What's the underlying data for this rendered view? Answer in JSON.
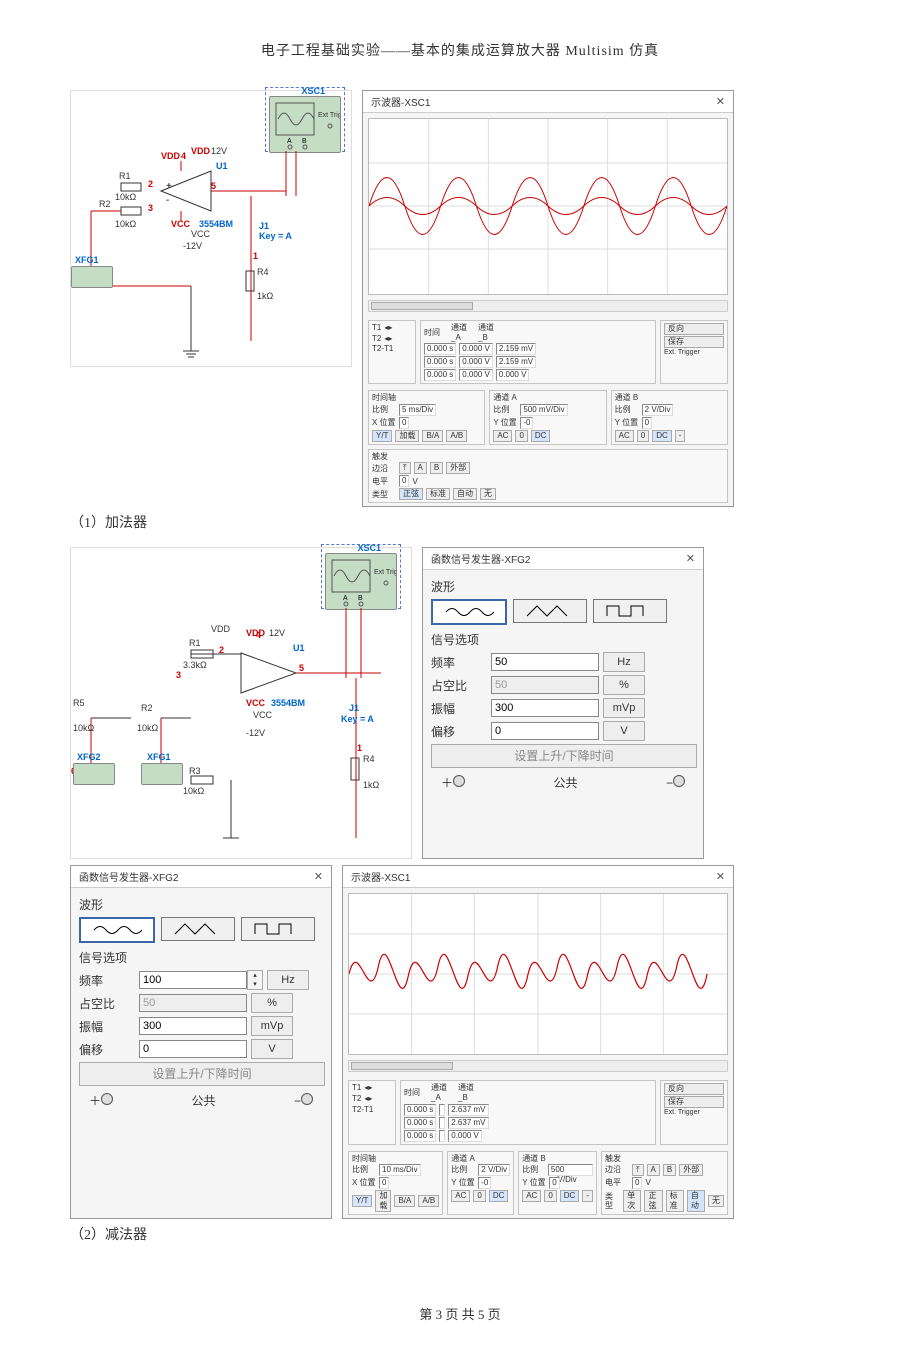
{
  "header": "电子工程基础实验——基本的集成运算放大器 Multisim 仿真",
  "footer": "第 3 页 共 5 页",
  "captions": {
    "c1": "（1）加法器",
    "c2": "（2）减法器"
  },
  "osc": {
    "title": "示波器-XSC1",
    "rev_btn": "反向",
    "save_btn": "保存",
    "ext": "Ext. Trigger",
    "rows": {
      "T1_t": "0.000 s",
      "T1_a": "0.000 V",
      "T1_b": "2.159 mV",
      "T2_t": "0.000 s",
      "T2_a": "0.000 V",
      "T2_b": "2.159 mV",
      "TT_t": "0.000 s",
      "TT_a": "0.000 V",
      "TT_b": "0.000 V"
    },
    "labels": {
      "time": "时间",
      "chA": "通道_A",
      "chB": "通道_B",
      "T1": "T1",
      "T2": "T2",
      "TT": "T2-T1"
    },
    "groups": {
      "time": {
        "title": "时间轴",
        "scale_k": "比例",
        "scale_v": "5 ms/Div",
        "x_k": "X 位置",
        "x_v": "0",
        "btns": [
          "Y/T",
          "加载",
          "B/A",
          "A/B"
        ]
      },
      "chA": {
        "title": "通道 A",
        "scale_k": "比例",
        "scale_v": "500 mV/Div",
        "y_k": "Y 位置",
        "y_v": "-0",
        "btns": [
          "AC",
          "0",
          "DC"
        ]
      },
      "chB": {
        "title": "通道 B",
        "scale_k": "比例",
        "scale_v": "2 V/Div",
        "y_k": "Y 位置",
        "y_v": "0",
        "btns": [
          "AC",
          "0",
          "DC",
          "-"
        ]
      },
      "trig": {
        "title": "触发",
        "edge": "边沿",
        "level": "电平",
        "level_v": "0",
        "unit": "V",
        "type": "类型",
        "btns": [
          "正弦",
          "标准",
          "自动",
          "无"
        ],
        "btns2": [
          "单次",
          "正弦",
          "标准",
          "自动",
          "无"
        ],
        "ab": [
          "A",
          "B",
          "外部"
        ]
      }
    }
  },
  "osc2": {
    "time_groups": {
      "time": {
        "scale_v": "10 ms/Div",
        "x_v": "0"
      },
      "chA": {
        "scale_v": "2 V/Div",
        "y_v": "-0"
      },
      "chB": {
        "scale_v": "500 mV/Div",
        "y_v": "0"
      }
    },
    "rows": {
      "T1_t": "0.000 s",
      "T1_a": "",
      "T1_b": "2.637 mV",
      "T2_t": "0.000 s",
      "T2_a": "",
      "T2_b": "2.637 mV",
      "TT_t": "0.000 s",
      "TT_a": "",
      "TT_b": "0.000 V"
    }
  },
  "fgen": {
    "title": "函数信号发生器-XFG2",
    "wave": "波形",
    "opts": "信号选项",
    "freq": "频率",
    "duty": "占空比",
    "amp": "振幅",
    "offset": "偏移",
    "rise": "设置上升/下降时间",
    "common": "公共",
    "a": {
      "freq": "50",
      "duty": "50",
      "amp": "300",
      "off": "0",
      "uf": "Hz",
      "ud": "%",
      "ua": "mVp",
      "uo": "V"
    },
    "b": {
      "freq": "100",
      "duty": "50",
      "amp": "300",
      "off": "0",
      "uf": "Hz",
      "ud": "%",
      "ua": "mVp",
      "uo": "V"
    }
  },
  "sch": {
    "xsc": "XSC1",
    "ext": "Ext Trig",
    "A": "A",
    "B": "B",
    "vdd": "VDD",
    "vcc": "VCC",
    "p12": "12V",
    "n12": "-12V",
    "u1": "U1",
    "part": "3554BM",
    "j1": "J1",
    "key": "Key = A",
    "r1": "R1",
    "r1v": "10kΩ",
    "r2": "R2",
    "r2v": "10kΩ",
    "r3": "R3",
    "r3v": "10kΩ",
    "r1b": "3.3kΩ",
    "r4": "R4",
    "r4v": "1kΩ",
    "r5": "R5",
    "r5v": "10kΩ",
    "xfg1": "XFG1",
    "xfg2": "XFG2"
  }
}
